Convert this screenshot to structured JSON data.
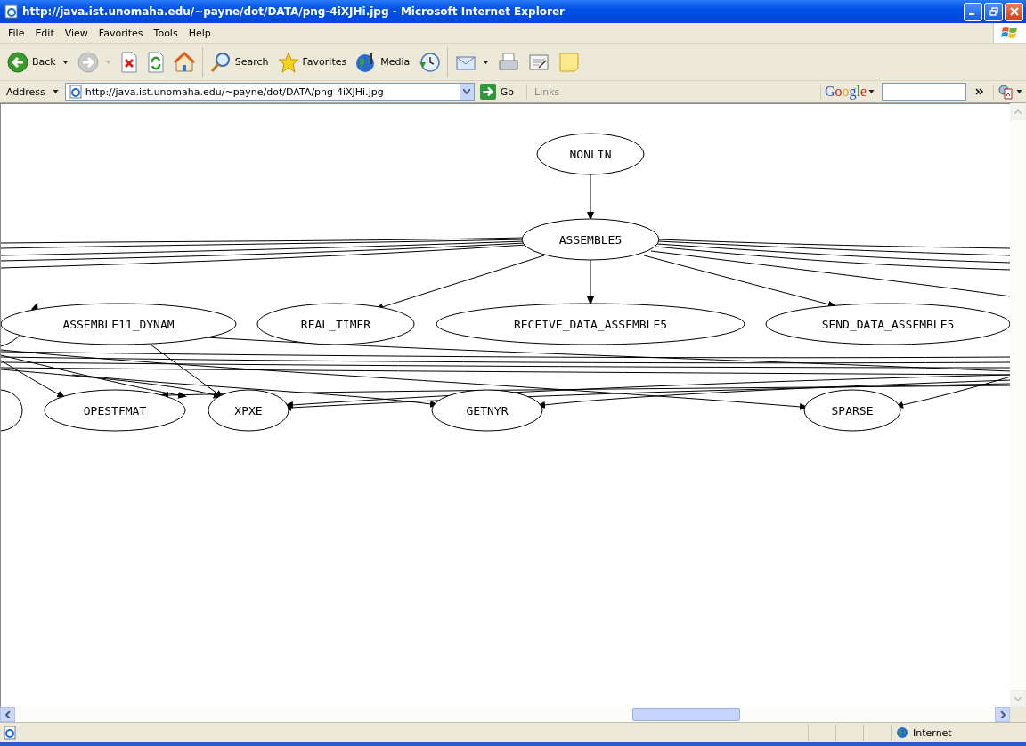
{
  "window": {
    "title": "http://java.ist.unomaha.edu/~payne/dot/DATA/png-4iXJHi.jpg - Microsoft Internet Explorer"
  },
  "menu": [
    "File",
    "Edit",
    "View",
    "Favorites",
    "Tools",
    "Help"
  ],
  "toolbar": [
    {
      "kind": "back",
      "label": "Back",
      "dropdown": true
    },
    {
      "kind": "forward",
      "dropdown": true
    },
    {
      "kind": "stop"
    },
    {
      "kind": "refresh"
    },
    {
      "kind": "home",
      "separator": true
    },
    {
      "kind": "search",
      "label": "Search"
    },
    {
      "kind": "favorites",
      "label": "Favorites"
    },
    {
      "kind": "media",
      "label": "Media"
    },
    {
      "kind": "history",
      "separator": true
    },
    {
      "kind": "mail",
      "dropdown": true
    },
    {
      "kind": "print"
    },
    {
      "kind": "edit"
    },
    {
      "kind": "note"
    }
  ],
  "address_bar": {
    "label": "Address",
    "url": "http://java.ist.unomaha.edu/~payne/dot/DATA/png-4iXJHi.jpg",
    "go": "Go",
    "links": "Links"
  },
  "google_toolbar": {
    "logo": "Google"
  },
  "graph": {
    "nodes": [
      {
        "label": "NONLIN"
      },
      {
        "label": "ASSEMBLE5"
      },
      {
        "label": "ASSEMBLE11_DYNAM"
      },
      {
        "label": "REAL_TIMER"
      },
      {
        "label": "RECEIVE_DATA_ASSEMBLE5"
      },
      {
        "label": "SEND_DATA_ASSEMBLE5"
      },
      {
        "label": "OPESTFMAT"
      },
      {
        "label": "XPXE"
      },
      {
        "label": "GETNYR"
      },
      {
        "label": "SPARSE"
      }
    ]
  },
  "status_bar": {
    "zone": "Internet"
  }
}
